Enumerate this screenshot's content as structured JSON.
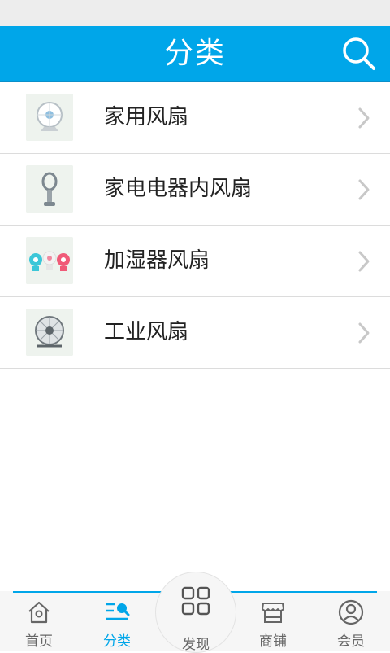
{
  "header": {
    "title": "分类"
  },
  "categories": [
    {
      "label": "家用风扇",
      "thumb_icon": "desk-fan-thumbnail"
    },
    {
      "label": "家电电器内风扇",
      "thumb_icon": "bladeless-fan-thumbnail"
    },
    {
      "label": "加湿器风扇",
      "thumb_icon": "mini-fans-thumbnail"
    },
    {
      "label": "工业风扇",
      "thumb_icon": "industrial-fan-thumbnail"
    }
  ],
  "tabbar": {
    "tabs": [
      {
        "label": "首页",
        "icon": "home-icon"
      },
      {
        "label": "分类",
        "icon": "category-icon",
        "active": true
      },
      {
        "label": "发现",
        "icon": "grid-icon"
      },
      {
        "label": "商铺",
        "icon": "store-icon"
      },
      {
        "label": "会员",
        "icon": "user-icon"
      }
    ]
  },
  "colors": {
    "accent": "#00a6e9",
    "status_bar": "#ededed",
    "divider": "#dcdcdc"
  }
}
